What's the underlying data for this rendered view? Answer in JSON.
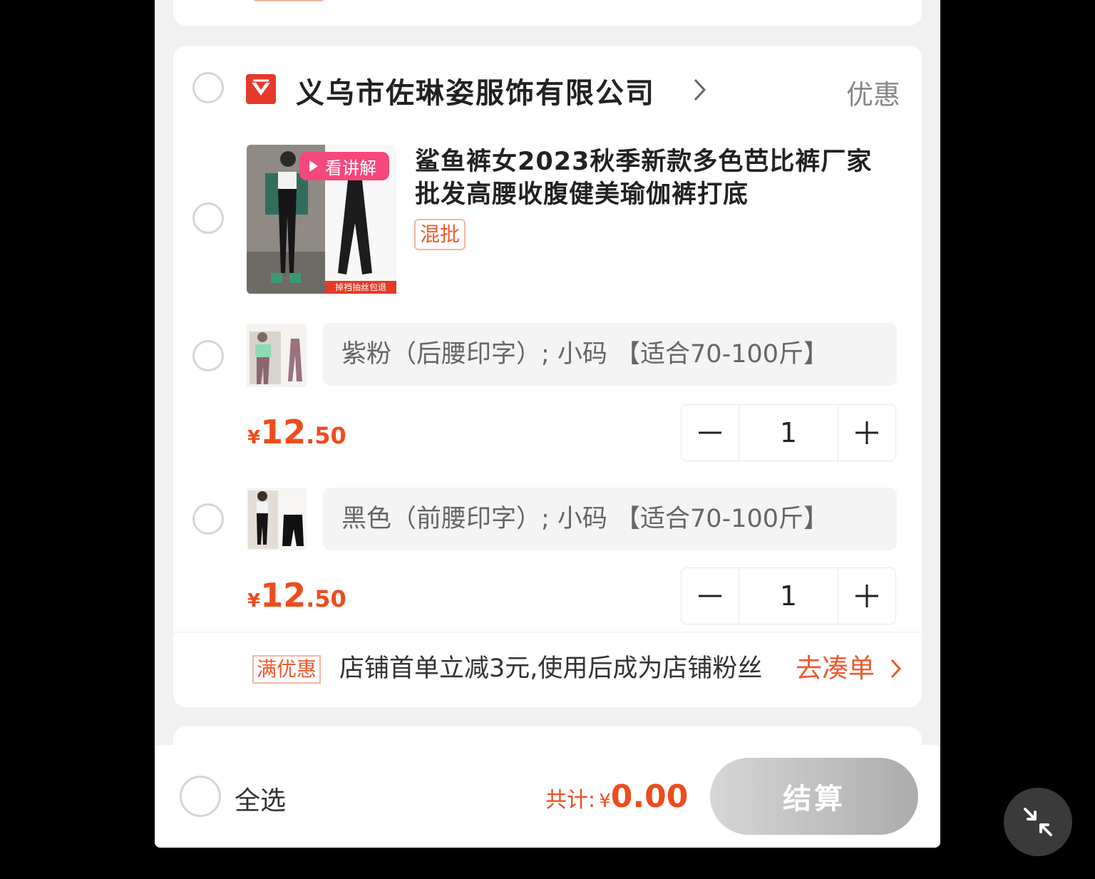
{
  "shop": {
    "name": "义乌市佐琳姿服饰有限公司",
    "promo_link": "优惠"
  },
  "product": {
    "video_badge": "看讲解",
    "thumb_promo": "掉裆抽丝包退",
    "title": "鲨鱼裤女2023秋季新款多色芭比裤厂家批发高腰收腹健美瑜伽裤打底",
    "mix_tag": "混批"
  },
  "skus": [
    {
      "label": "紫粉（后腰印字）; 小码 【适合70-100斤】",
      "price_currency": "¥",
      "price_int": "12",
      "price_dec": ".50",
      "quantity": "1"
    },
    {
      "label": "黑色（前腰印字）; 小码 【适合70-100斤】",
      "price_currency": "¥",
      "price_int": "12",
      "price_dec": ".50",
      "quantity": "1"
    }
  ],
  "discount": {
    "tag": "满优惠",
    "text": "店铺首单立减3元,使用后成为店铺粉丝",
    "link": "去凑单"
  },
  "bottom": {
    "select_all": "全选",
    "total_label": "共计:",
    "total_currency": "¥",
    "total_value": "0.00",
    "checkout": "结算"
  },
  "colors": {
    "accent": "#ee4c1c",
    "shop_logo": "#e53a2a",
    "video_badge": "#f5487c"
  }
}
